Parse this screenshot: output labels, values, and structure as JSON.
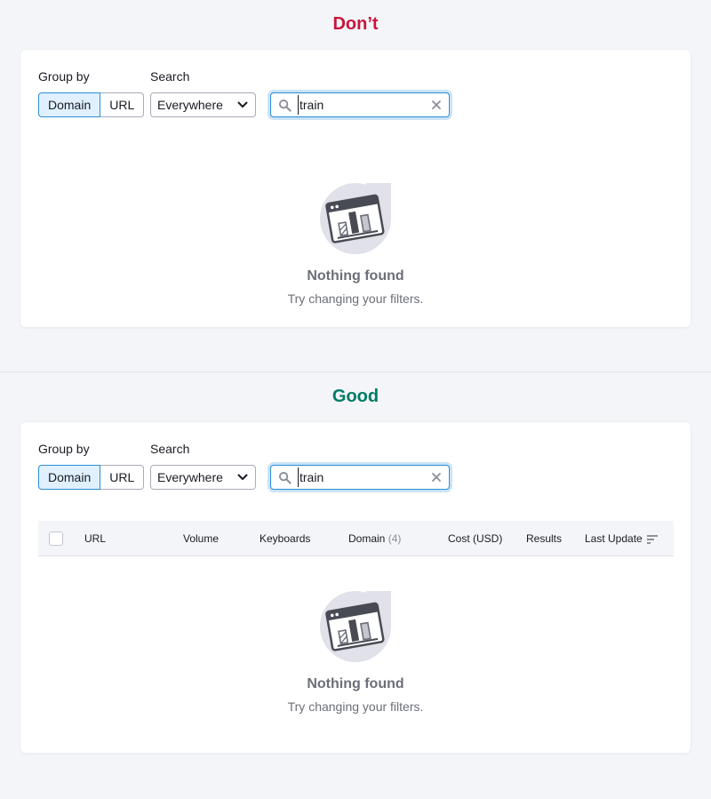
{
  "sections": [
    {
      "title": "Don’t",
      "group_by_label": "Group by",
      "group_options": [
        "Domain",
        "URL"
      ],
      "search_label": "Search",
      "select_value": "Everywhere",
      "search_value": "train",
      "empty_title": "Nothing found",
      "empty_subtitle": "Try changing your filters."
    },
    {
      "title": "Good",
      "group_by_label": "Group by",
      "group_options": [
        "Domain",
        "URL"
      ],
      "search_label": "Search",
      "select_value": "Everywhere",
      "search_value": "train",
      "table_columns": {
        "url": "URL",
        "volume": "Volume",
        "keyboards": "Keyboards",
        "domain": "Domain",
        "domain_count": "(4)",
        "cost": "Cost (USD)",
        "results": "Results",
        "last_update": "Last Update"
      },
      "empty_title": "Nothing found",
      "empty_subtitle": "Try changing your filters."
    }
  ],
  "colors": {
    "dont": "#c8153b",
    "good": "#007c65",
    "focus": "#2b8fd6"
  },
  "icons": {
    "search": "search-icon",
    "clear": "close-icon",
    "select": "chevron-down-icon",
    "sort": "sort-icon",
    "empty": "empty-state-illustration"
  }
}
